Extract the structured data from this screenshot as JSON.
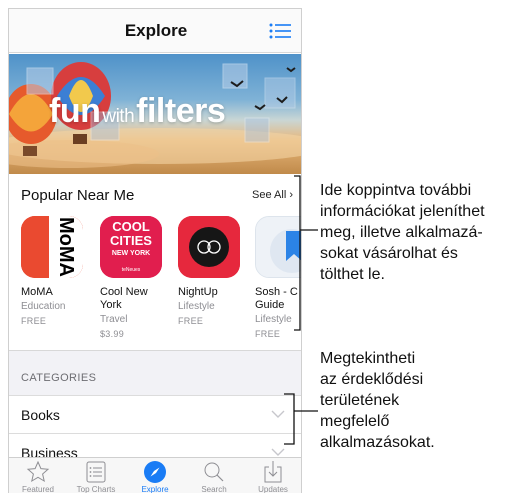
{
  "navbar": {
    "title": "Explore",
    "menu_icon": "list-icon"
  },
  "banner": {
    "headline_a": "fun",
    "headline_b": "with",
    "headline_c": "filters"
  },
  "popular": {
    "title": "Popular Near Me",
    "see_all": "See All",
    "apps": [
      {
        "tile_text": "MoMA",
        "name": "MoMA",
        "category": "Education",
        "price": "FREE",
        "color": "#e8402b"
      },
      {
        "tile_line1": "COOL",
        "tile_line2": "CITIES",
        "tile_line3": "NEW YORK",
        "tile_brand": "teNeues",
        "name": "Cool New",
        "name2": "York",
        "category": "Travel",
        "price": "$3.99",
        "color": "#e31d4b"
      },
      {
        "name": "NightUp",
        "category": "Lifestyle",
        "price": "FREE",
        "color": "#e52b40"
      },
      {
        "name": "Sosh - C",
        "name2": "Guide",
        "category": "Lifestyle",
        "price": "FREE",
        "color": "#2b83e6"
      }
    ]
  },
  "categories": {
    "header": "CATEGORIES",
    "items": [
      {
        "label": "Books"
      },
      {
        "label": "Business"
      }
    ]
  },
  "tabbar": {
    "tabs": [
      {
        "label": "Featured",
        "icon": "star-icon"
      },
      {
        "label": "Top Charts",
        "icon": "list-icon"
      },
      {
        "label": "Explore",
        "icon": "compass-icon",
        "active": true
      },
      {
        "label": "Search",
        "icon": "search-icon"
      },
      {
        "label": "Updates",
        "icon": "download-icon"
      }
    ],
    "active_color": "#1a7cf5"
  },
  "callouts": {
    "top": [
      "Ide koppintva további",
      "információkat jeleníthet",
      "meg, illetve alkalmazá-",
      "sokat vásárolhat és",
      "tölthet le."
    ],
    "bottom": [
      "Megtekintheti",
      "az érdeklődési",
      "területének",
      "megfelelő",
      "alkalmazásokat."
    ]
  }
}
